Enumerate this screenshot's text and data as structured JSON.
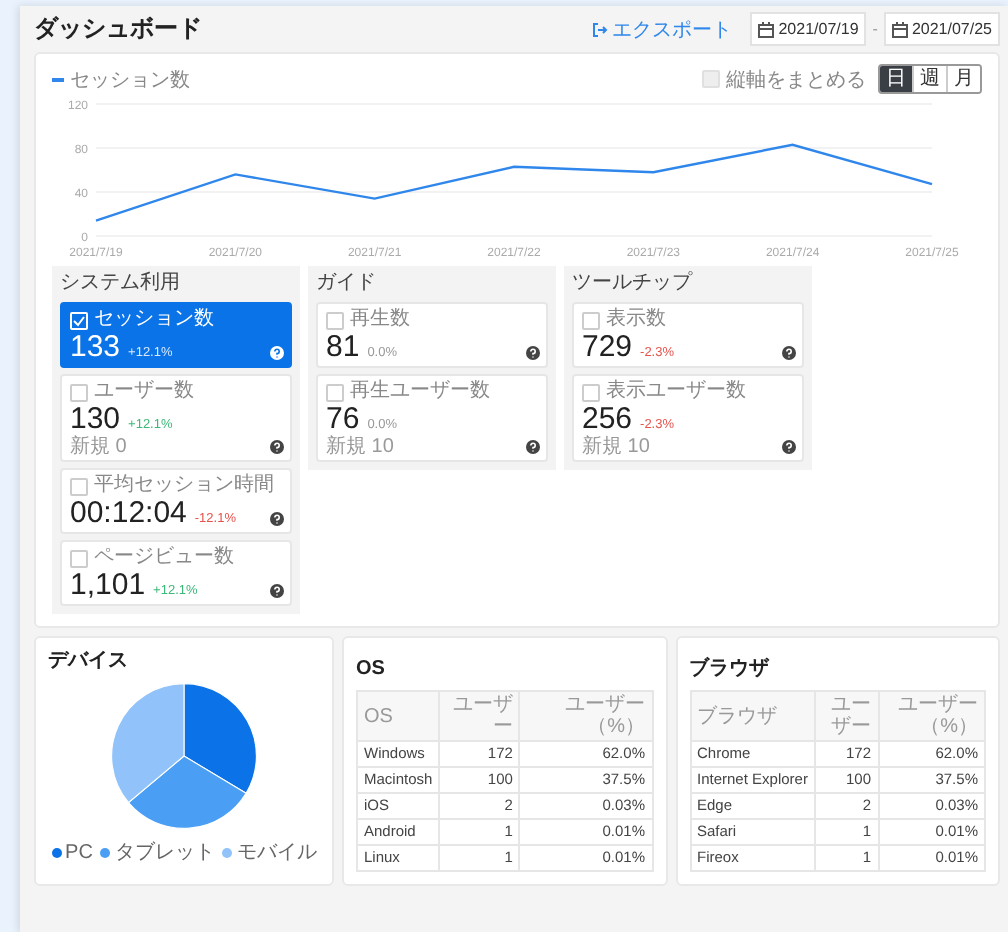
{
  "header": {
    "title": "ダッシュボード",
    "export": "エクスポート",
    "date_from": "2021/07/19",
    "date_separator": "-",
    "date_to": "2021/07/25"
  },
  "chart_panel": {
    "merge_axis": {
      "label": "縦軸をまとめる",
      "checked": false
    },
    "periods": [
      {
        "label": "日",
        "selected": true
      },
      {
        "label": "週",
        "selected": false
      },
      {
        "label": "月",
        "selected": false
      }
    ],
    "chart_data": {
      "type": "line",
      "categories": [
        "2021/7/19",
        "2021/7/20",
        "2021/7/21",
        "2021/7/22",
        "2021/7/23",
        "2021/7/24",
        "2021/7/25"
      ],
      "series": [
        {
          "name": "セッション数",
          "color": "#2f86eb",
          "values": [
            14,
            56,
            34,
            63,
            58,
            83,
            47
          ]
        }
      ],
      "ylim": [
        0,
        120
      ],
      "yticks": [
        0,
        40,
        80,
        120
      ]
    }
  },
  "metric_groups": [
    {
      "title": "システム利用",
      "cards": [
        {
          "label": "セッション数",
          "value": "133",
          "change": "+12.1%",
          "color": "#dbe9ff",
          "selected": true
        },
        {
          "label": "ユーザー数",
          "value": "130",
          "change": "+12.1%",
          "color": "#3cb878",
          "sub": "新規 0",
          "selected": false
        },
        {
          "label": "平均セッション時間",
          "value": "00:12:04",
          "change": "-12.1%",
          "color": "#e5534b",
          "selected": false
        },
        {
          "label": "ページビュー数",
          "value": "1,101",
          "change": "+12.1%",
          "color": "#3cb878",
          "selected": false
        }
      ]
    },
    {
      "title": "ガイド",
      "cards": [
        {
          "label": "再生数",
          "value": "81",
          "change": "0.0%",
          "color": "#999999",
          "selected": false
        },
        {
          "label": "再生ユーザー数",
          "value": "76",
          "change": "0.0%",
          "color": "#999999",
          "sub": "新規 10",
          "selected": false
        }
      ]
    },
    {
      "title": "ツールチップ",
      "cards": [
        {
          "label": "表示数",
          "value": "729",
          "change": "-2.3%",
          "color": "#e5534b",
          "selected": false
        },
        {
          "label": "表示ユーザー数",
          "value": "256",
          "change": "-2.3%",
          "color": "#e5534b",
          "sub": "新規 10",
          "selected": false
        }
      ]
    }
  ],
  "device": {
    "title": "デバイス",
    "legend": [
      {
        "label": "PC",
        "color": "#0b72e7"
      },
      {
        "label": "タブレット",
        "color": "#4a9ff5"
      },
      {
        "label": "モバイル",
        "color": "#91c3fa"
      }
    ]
  },
  "tables": [
    {
      "title": "OS",
      "columns": [
        "OS",
        "ユーザー",
        "ユーザー（%）"
      ],
      "rows": [
        [
          "Windows",
          "172",
          "62.0%"
        ],
        [
          "Macintosh",
          "100",
          "37.5%"
        ],
        [
          "iOS",
          "2",
          "0.03%"
        ],
        [
          "Android",
          "1",
          "0.01%"
        ],
        [
          "Linux",
          "1",
          "0.01%"
        ]
      ]
    },
    {
      "title": "ブラウザ",
      "columns": [
        "ブラウザ",
        "ユーザー",
        "ユーザー（%）"
      ],
      "rows": [
        [
          "Chrome",
          "172",
          "62.0%"
        ],
        [
          "Internet Explorer",
          "100",
          "37.5%"
        ],
        [
          "Edge",
          "2",
          "0.03%"
        ],
        [
          "Safari",
          "1",
          "0.01%"
        ],
        [
          "Fireox",
          "1",
          "0.01%"
        ]
      ]
    }
  ]
}
